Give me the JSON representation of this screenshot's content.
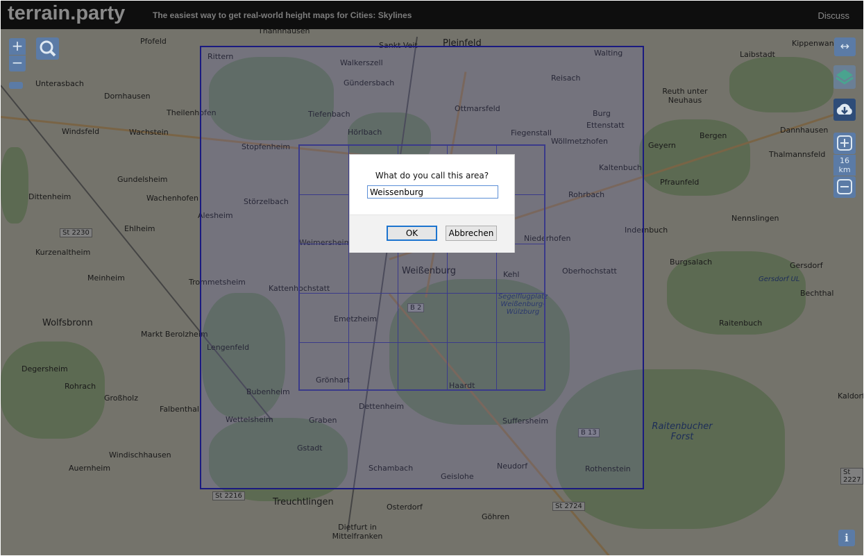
{
  "header": {
    "logo": "terrain.party",
    "tagline": "The easiest way to get real-world height maps for Cities: Skylines",
    "discuss": "Discuss"
  },
  "controls": {
    "zoom_in": "+",
    "zoom_out": "−",
    "search_icon": "search-icon",
    "rotate": "↔",
    "scale_value": "16",
    "scale_unit": "km",
    "info": "i"
  },
  "dialog": {
    "message": "What do you call this area?",
    "input_value": "Weissenburg",
    "ok": "OK",
    "cancel": "Abbrechen"
  },
  "map": {
    "labels": [
      "Thannhausen",
      "Pfofeld",
      "Sankt Veit",
      "Pleinfeld",
      "Walting",
      "Laibstadt",
      "Kippenwang",
      "Rittern",
      "Walkerszell",
      "Unterasbach",
      "Gündersbach",
      "Reisach",
      "Dornhausen",
      "Reuth unter Neuhaus",
      "Theilenhofen",
      "Tiefenbach",
      "Ottmarsfeld",
      "Burg",
      "Windsfeld",
      "Wachstein",
      "Hörlbach",
      "Fiegenstall",
      "Ettenstatt",
      "Dannhausen",
      "Wöllmetzhofen",
      "Geyern",
      "Bergen",
      "Thalmannsfeld",
      "Stopfenheim",
      "Kaltenbuch",
      "Gundelsheim",
      "Pfraunfeld",
      "Dittenheim",
      "Wachenhofen",
      "Alesheim",
      "Störzelbach",
      "Rohrbach",
      "Ehlheim",
      "Indernbuch",
      "Nennslingen",
      "Weimersheim",
      "Niederhofen",
      "Kurzenaltheim",
      "Burgsalach",
      "Gersdorf",
      "Meinheim",
      "Trommetsheim",
      "Kattenhochstatt",
      "Weißenburg",
      "Kehl",
      "Oberhochstatt",
      "Segelflugplatz Weißenburg-Wülzburg",
      "Bechthal",
      "Wolfsbronn",
      "Emetzheim",
      "Raitenbuch",
      "Markt Berolzheim",
      "Lengenfeld",
      "Degersheim",
      "Grönhart",
      "Haardt",
      "Rohrach",
      "Bubenheim",
      "Großholz",
      "Falbenthal",
      "Dettenheim",
      "Wettelsheim",
      "Graben",
      "Suffersheim",
      "Raitenbucher Forst",
      "Windischhausen",
      "Gstadt",
      "Schambach",
      "Neudorf",
      "Auernheim",
      "Geislohe",
      "Rothenstein",
      "Treuchtlingen",
      "Osterdorf",
      "Göhren",
      "Dietfurt in Mittelfranken",
      "Gersdorf UL",
      "Kaldorf"
    ],
    "roads": [
      "St 2230",
      "B 2",
      "B 13",
      "St 2216",
      "St 2724",
      "St 2227"
    ]
  }
}
